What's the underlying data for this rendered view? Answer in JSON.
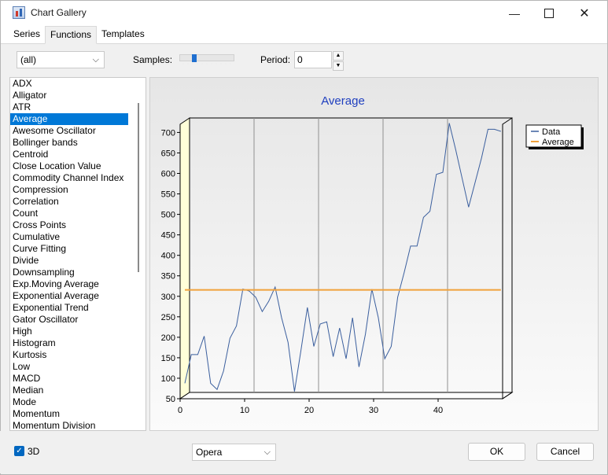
{
  "window": {
    "title": "Chart Gallery"
  },
  "tabs": [
    {
      "label": "Series"
    },
    {
      "label": "Functions"
    },
    {
      "label": "Templates"
    }
  ],
  "toolbar": {
    "filter_value": "(all)",
    "samples_label": "Samples:",
    "samples_level": 0.25,
    "period_label": "Period:",
    "period_value": "0"
  },
  "functions": [
    "ADX",
    "Alligator",
    "ATR",
    "Average",
    "Awesome Oscillator",
    "Bollinger bands",
    "Centroid",
    "Close Location Value",
    "Commodity Channel Index",
    "Compression",
    "Correlation",
    "Count",
    "Cross Points",
    "Cumulative",
    "Curve Fitting",
    "Divide",
    "Downsampling",
    "Exp.Moving Average",
    "Exponential Average",
    "Exponential Trend",
    "Gator Oscillator",
    "High",
    "Histogram",
    "Kurtosis",
    "Low",
    "MACD",
    "Median",
    "Mode",
    "Momentum",
    "Momentum Division"
  ],
  "selected_function": "Average",
  "footer": {
    "checkbox_3d_label": "3D",
    "theme_value": "Opera",
    "ok_label": "OK",
    "cancel_label": "Cancel"
  },
  "colors": {
    "data_series": "#3b5f9e",
    "average_series": "#f0a23c",
    "title": "#1f3fbf",
    "selection": "#0078d7"
  },
  "chart_data": {
    "type": "line",
    "title": "Average",
    "xlim": [
      0,
      50
    ],
    "ylim": [
      50,
      720
    ],
    "xticks": [
      0,
      10,
      20,
      30,
      40
    ],
    "yticks": [
      50,
      100,
      150,
      200,
      250,
      300,
      350,
      400,
      450,
      500,
      550,
      600,
      650,
      700
    ],
    "legend_position": "right",
    "series": [
      {
        "name": "Data",
        "x": [
          0,
          1,
          2,
          3,
          4,
          5,
          6,
          7,
          8,
          9,
          10,
          11,
          12,
          13,
          14,
          15,
          16,
          17,
          18,
          19,
          20,
          21,
          22,
          23,
          24,
          25,
          26,
          27,
          28,
          29,
          30,
          31,
          32,
          33,
          34,
          35,
          36,
          37,
          38,
          39,
          40,
          41,
          42,
          43,
          44,
          45,
          46,
          47,
          48,
          49
        ],
        "y": [
          80,
          150,
          150,
          195,
          80,
          65,
          110,
          190,
          220,
          310,
          305,
          290,
          255,
          280,
          315,
          240,
          180,
          60,
          160,
          265,
          170,
          225,
          230,
          145,
          215,
          140,
          240,
          120,
          200,
          310,
          240,
          140,
          170,
          290,
          350,
          415,
          415,
          485,
          500,
          590,
          595,
          715,
          650,
          580,
          510,
          570,
          630,
          700,
          700,
          695
        ]
      },
      {
        "name": "Average",
        "x": [
          0,
          49
        ],
        "y": [
          308,
          308
        ]
      }
    ]
  }
}
